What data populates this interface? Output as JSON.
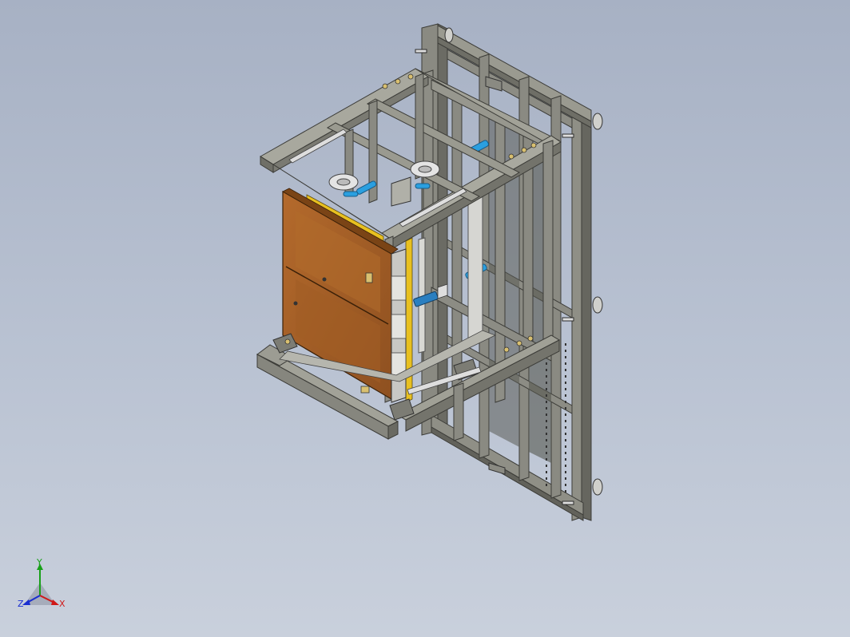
{
  "viewport": {
    "background_top": "#a7b1c4",
    "background_bottom": "#c9d0dc"
  },
  "model": {
    "frame_color": "#8e8e86",
    "frame_dark": "#5f605a",
    "frame_light": "#b8b8ae",
    "panel_color": "#a45f26",
    "panel_light": "#c0752f",
    "accent_yellow": "#e8c020",
    "accent_blue": "#2a9fe0",
    "handwheel_color": "#e4e4e4"
  },
  "triad": {
    "x_label": "X",
    "y_label": "Y",
    "z_label": "Z",
    "x_color": "#d01818",
    "y_color": "#18a018",
    "z_color": "#1a2ed0"
  }
}
